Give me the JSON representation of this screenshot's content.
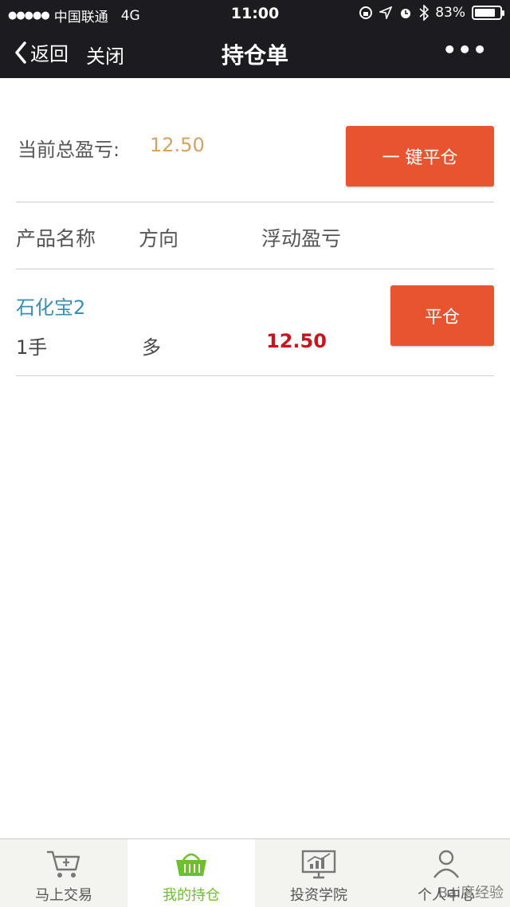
{
  "status_bar": {
    "carrier": "中国联通",
    "network": "4G",
    "time": "11:00",
    "battery": "83%",
    "battery_level": 0.83
  },
  "nav": {
    "back_label": "返回",
    "close_label": "关闭",
    "title": "持仓单",
    "more_label": "•••"
  },
  "summary": {
    "label": "当前总盈亏:",
    "value": "12.50",
    "close_all_label": "一 键平仓"
  },
  "table": {
    "headers": [
      "产品名称",
      "方向",
      "浮动盈亏"
    ],
    "rows": [
      {
        "product": "石化宝2",
        "quantity": "1手",
        "direction": "多",
        "floating_pnl": "12.50",
        "close_label": "平仓"
      }
    ]
  },
  "tabbar": {
    "tabs": [
      {
        "label": "马上交易",
        "icon": "cart-icon"
      },
      {
        "label": "我的持仓",
        "icon": "basket-icon",
        "active": true
      },
      {
        "label": "投资学院",
        "icon": "monitor-chart-icon"
      },
      {
        "label": "个人中心",
        "icon": "person-icon"
      }
    ]
  },
  "colors": {
    "nav_bg": "#1c1b1f",
    "accent_orange": "#e8542f",
    "total_pnl": "#d8a160",
    "pnl_red": "#c8141e",
    "product_blue": "#3b8fb3",
    "tab_active": "#6cbf2d"
  },
  "watermark": "Bai度经验"
}
